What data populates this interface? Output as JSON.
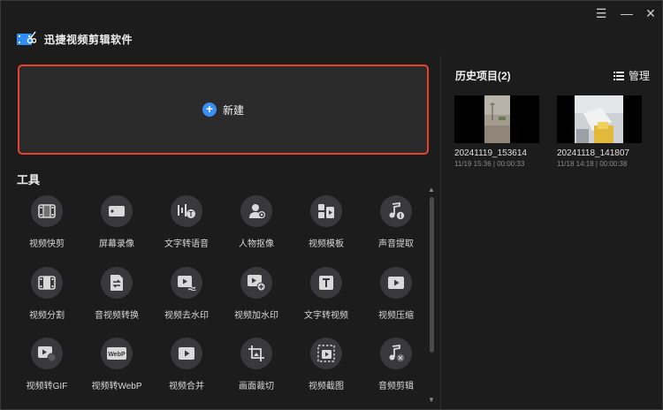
{
  "app": {
    "title": "迅捷视频剪辑软件"
  },
  "window": {
    "menu_glyph": "☰",
    "minimize_glyph": "—",
    "close_glyph": "✕"
  },
  "new_project": {
    "label": "新建",
    "plus_glyph": "+"
  },
  "tools": {
    "title": "工具",
    "items": [
      {
        "label": "视频快剪",
        "icon": "film-icon"
      },
      {
        "label": "屏幕录像",
        "icon": "camera-record-icon"
      },
      {
        "label": "文字转语音",
        "icon": "text-to-speech-icon"
      },
      {
        "label": "人物抠像",
        "icon": "person-cutout-icon"
      },
      {
        "label": "视频模板",
        "icon": "template-icon"
      },
      {
        "label": "声音提取",
        "icon": "music-extract-icon"
      },
      {
        "label": "视频分割",
        "icon": "split-icon"
      },
      {
        "label": "音视频转换",
        "icon": "convert-icon"
      },
      {
        "label": "视频去水印",
        "icon": "remove-watermark-icon"
      },
      {
        "label": "视频加水印",
        "icon": "add-watermark-icon"
      },
      {
        "label": "文字转视频",
        "icon": "text-to-video-icon"
      },
      {
        "label": "视频压缩",
        "icon": "compress-icon"
      },
      {
        "label": "视频转GIF",
        "icon": "gif-icon"
      },
      {
        "label": "视频转WebP",
        "icon": "webp-icon",
        "badge": "WebP"
      },
      {
        "label": "视频合并",
        "icon": "merge-icon"
      },
      {
        "label": "画面裁切",
        "icon": "crop-icon"
      },
      {
        "label": "视频截图",
        "icon": "screenshot-icon"
      },
      {
        "label": "音频剪辑",
        "icon": "audio-edit-icon"
      }
    ]
  },
  "history": {
    "title": "历史项目(2)",
    "manage_label": "管理",
    "items": [
      {
        "name": "20241119_153614",
        "meta": "11/19 15:36 | 00:00:33"
      },
      {
        "name": "20241118_141807",
        "meta": "11/18 14:18 | 00:00:38"
      }
    ]
  },
  "colors": {
    "accent_border": "#e8422f",
    "plus_blue": "#3a8ef6",
    "background": "#1c1c1d"
  }
}
